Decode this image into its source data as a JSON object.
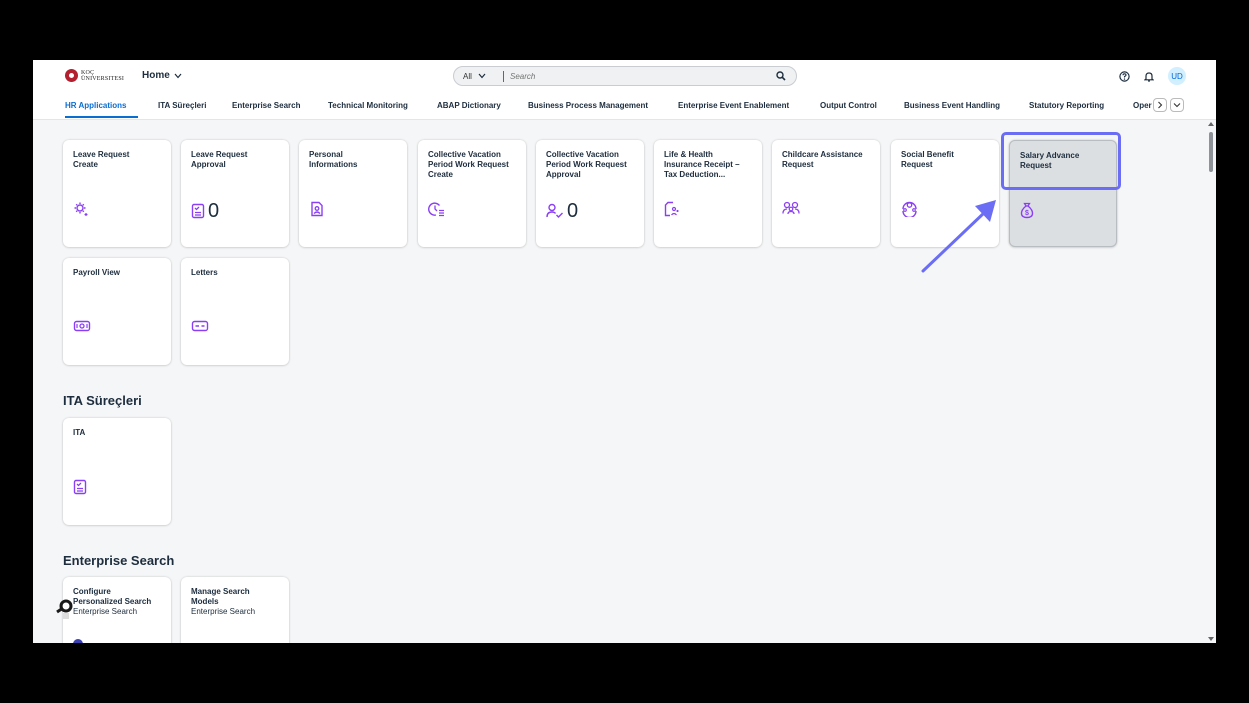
{
  "shell": {
    "logo_line1": "KOÇ",
    "logo_line2": "ÜNIVERSITESI",
    "home": "Home",
    "search_scope": "All",
    "search_placeholder": "Search",
    "avatar_initials": "UD"
  },
  "tabs": [
    {
      "label": "HR Applications"
    },
    {
      "label": "ITA Süreçleri"
    },
    {
      "label": "Enterprise Search"
    },
    {
      "label": "Technical Monitoring"
    },
    {
      "label": "ABAP Dictionary"
    },
    {
      "label": "Business Process Management"
    },
    {
      "label": "Enterprise Event Enablement"
    },
    {
      "label": "Output Control"
    },
    {
      "label": "Business Event Handling"
    },
    {
      "label": "Statutory Reporting"
    },
    {
      "label": "Oper"
    }
  ],
  "hr_tiles": [
    {
      "title": "Leave Request\nCreate"
    },
    {
      "title": "Leave Request\nApproval",
      "count": "0"
    },
    {
      "title": "Personal\nInformations"
    },
    {
      "title": "Collective Vacation\nPeriod Work Request\nCreate"
    },
    {
      "title": "Collective Vacation\nPeriod Work Request\nApproval",
      "count": "0"
    },
    {
      "title": "Life & Health\nInsurance Receipt –\nTax Deduction..."
    },
    {
      "title": "Childcare Assistance\nRequest"
    },
    {
      "title": "Social Benefit\nRequest"
    },
    {
      "title": "Salary Advance\nRequest"
    },
    {
      "title": "Payroll View"
    },
    {
      "title": "Letters"
    }
  ],
  "sections": {
    "ita": "ITA Süreçleri",
    "enterprise_search": "Enterprise Search"
  },
  "ita_tiles": [
    {
      "title": "ITA"
    }
  ],
  "es_tiles": [
    {
      "title": "Configure\nPersonalized Search",
      "subtitle": "Enterprise Search"
    },
    {
      "title": "Manage Search\nModels",
      "subtitle": "Enterprise Search"
    }
  ],
  "colors": {
    "accent": "#0a6ed1",
    "icon": "#8b3ff4",
    "annotation": "#6b6ef4"
  }
}
